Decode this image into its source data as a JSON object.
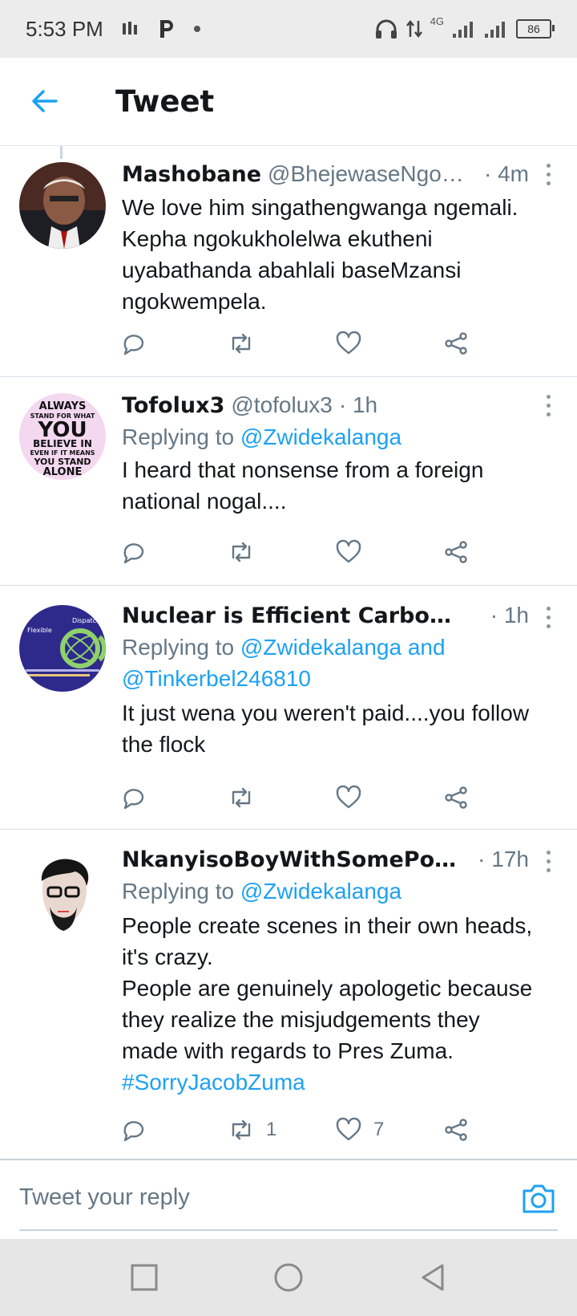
{
  "status_bar": {
    "time": "5:53 PM",
    "battery": "86",
    "network": "4G"
  },
  "header": {
    "title": "Tweet"
  },
  "tweets": [
    {
      "name": "Mashobane",
      "handle": "@BhejewaseNgo…",
      "time": "· 4m",
      "replying_label": "",
      "text": [
        "We love him singathengwanga ngemali.",
        "Kepha ngokukholelwa ekutheni",
        "uyabathanda abahlali baseMzansi",
        "ngokwempela."
      ],
      "retweets": "",
      "likes": ""
    },
    {
      "name": "Tofolux3",
      "handle": "@tofolux3",
      "time": "· 1h",
      "replying_label": "Replying to",
      "mentions": [
        "@Zwidekalanga"
      ],
      "text": [
        "I heard that nonsense from a foreign",
        "national nogal...."
      ],
      "avatar_text": [
        "ALWAYS",
        "STAND FOR WHAT",
        "YOU",
        "BELIEVE IN",
        "EVEN IF IT MEANS",
        "YOU STAND",
        "ALONE"
      ],
      "retweets": "",
      "likes": ""
    },
    {
      "name": "Nuclear is Efficient Carbon-fre…",
      "handle": "",
      "time": "· 1h",
      "replying_label": "Replying to",
      "mentions_line1": "@Zwidekalanga and",
      "mentions_line2": "@Tinkerbel246810",
      "text": [
        "It just wena you weren't paid....you follow",
        "the flock"
      ],
      "avatar_text": [
        "Flexible",
        "Dispatch"
      ],
      "retweets": "",
      "likes": ""
    },
    {
      "name": "NkanyisoBoyWithSomePower …",
      "handle": "",
      "time": "· 17h",
      "replying_label": "Replying to",
      "mentions": [
        "@Zwidekalanga"
      ],
      "text": [
        "People create scenes in their own heads,",
        "it's crazy.",
        "People are genuinely apologetic because",
        "they realize the misjudgements they",
        "made with regards to Pres Zuma."
      ],
      "hashtag": "#SorryJacobZuma",
      "retweets": "1",
      "likes": "7"
    }
  ],
  "compose": {
    "placeholder": "Tweet your reply"
  },
  "colors": {
    "accent": "#1da1f2",
    "secondary_text": "#657786",
    "primary_text": "#14171a"
  }
}
